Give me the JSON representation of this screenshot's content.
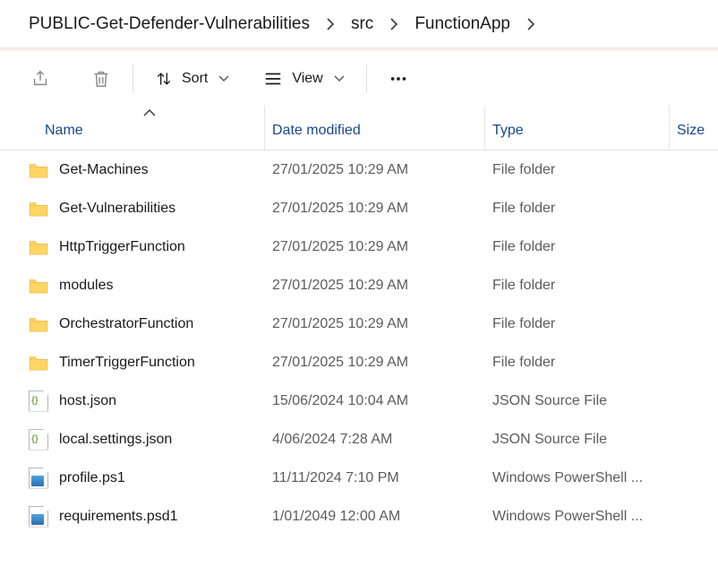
{
  "breadcrumb": {
    "items": [
      "PUBLIC-Get-Defender-Vulnerabilities",
      "src",
      "FunctionApp"
    ]
  },
  "toolbar": {
    "sort_label": "Sort",
    "view_label": "View"
  },
  "columns": {
    "name": "Name",
    "date": "Date modified",
    "type": "Type",
    "size": "Size"
  },
  "rows": [
    {
      "icon": "folder",
      "name": "Get-Machines",
      "date": "27/01/2025 10:29 AM",
      "type": "File folder"
    },
    {
      "icon": "folder",
      "name": "Get-Vulnerabilities",
      "date": "27/01/2025 10:29 AM",
      "type": "File folder"
    },
    {
      "icon": "folder",
      "name": "HttpTriggerFunction",
      "date": "27/01/2025 10:29 AM",
      "type": "File folder"
    },
    {
      "icon": "folder",
      "name": "modules",
      "date": "27/01/2025 10:29 AM",
      "type": "File folder"
    },
    {
      "icon": "folder",
      "name": "OrchestratorFunction",
      "date": "27/01/2025 10:29 AM",
      "type": "File folder"
    },
    {
      "icon": "folder",
      "name": "TimerTriggerFunction",
      "date": "27/01/2025 10:29 AM",
      "type": "File folder"
    },
    {
      "icon": "json",
      "name": "host.json",
      "date": "15/06/2024 10:04 AM",
      "type": "JSON Source File"
    },
    {
      "icon": "json",
      "name": "local.settings.json",
      "date": "4/06/2024 7:28 AM",
      "type": "JSON Source File"
    },
    {
      "icon": "ps1",
      "name": "profile.ps1",
      "date": "11/11/2024 7:10 PM",
      "type": "Windows PowerShell ..."
    },
    {
      "icon": "ps1",
      "name": "requirements.psd1",
      "date": "1/01/2049 12:00 AM",
      "type": "Windows PowerShell ..."
    }
  ]
}
